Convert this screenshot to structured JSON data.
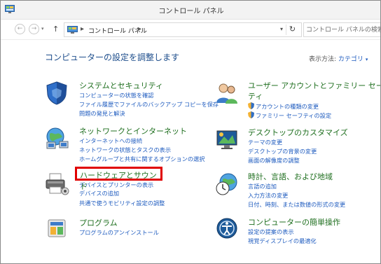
{
  "window": {
    "title": "コントロール パネル"
  },
  "nav": {
    "back_glyph": "←",
    "forward_glyph": "→",
    "history_glyph": "▾",
    "up_glyph": "↑",
    "breadcrumb_sep": "▸",
    "breadcrumb": "コントロール パネル",
    "dropdown_glyph": "▾",
    "refresh_glyph": "↻",
    "search_placeholder": "コントロール パネルの検索"
  },
  "main": {
    "heading": "コンピューターの設定を調整します",
    "view_by_label": "表示方法:",
    "view_by_value": "カテゴリ",
    "view_by_arrow": "▾"
  },
  "categories": [
    {
      "title": "システムとセキュリティ",
      "icon": "shield-icon",
      "links": [
        "コンピューターの状態を確認",
        "ファイル履歴でファイルのバックアップ コピーを保存",
        "問題の発見と解決"
      ]
    },
    {
      "title": "ネットワークとインターネット",
      "icon": "network-globe-icon",
      "links": [
        "インターネットへの接続",
        "ネットワークの状態とタスクの表示",
        "ホームグループと共有に関するオプションの選択"
      ]
    },
    {
      "title": "ハードウェアとサウンド",
      "icon": "printer-icon",
      "links": [
        "デバイスとプリンターの表示",
        "デバイスの追加",
        "共通で使うモビリティ設定の調整"
      ]
    },
    {
      "title": "プログラム",
      "icon": "programs-icon",
      "links": [
        "プログラムのアンインストール"
      ]
    },
    {
      "title_line1": "ユーザー アカウントとファミリー セーフ",
      "title_line2": "ティ",
      "icon": "users-icon",
      "links": [
        "アカウントの種類の変更",
        "ファミリー セーフティの設定"
      ]
    },
    {
      "title": "デスクトップのカスタマイズ",
      "icon": "desktop-icon",
      "links": [
        "テーマの変更",
        "デスクトップの背景の変更",
        "画面の解像度の調整"
      ]
    },
    {
      "title": "時計、言語、および地域",
      "icon": "clock-globe-icon",
      "links": [
        "言語の追加",
        "入力方法の変更",
        "日付、時刻、または数値の形式の変更"
      ]
    },
    {
      "title": "コンピューターの簡単操作",
      "icon": "ease-of-access-icon",
      "links": [
        "設定の提案の表示",
        "視覚ディスプレイの最適化"
      ]
    }
  ],
  "colors": {
    "accent_link": "#1e5bbf",
    "category_title": "#1f6f1f",
    "highlight": "#e00000"
  }
}
